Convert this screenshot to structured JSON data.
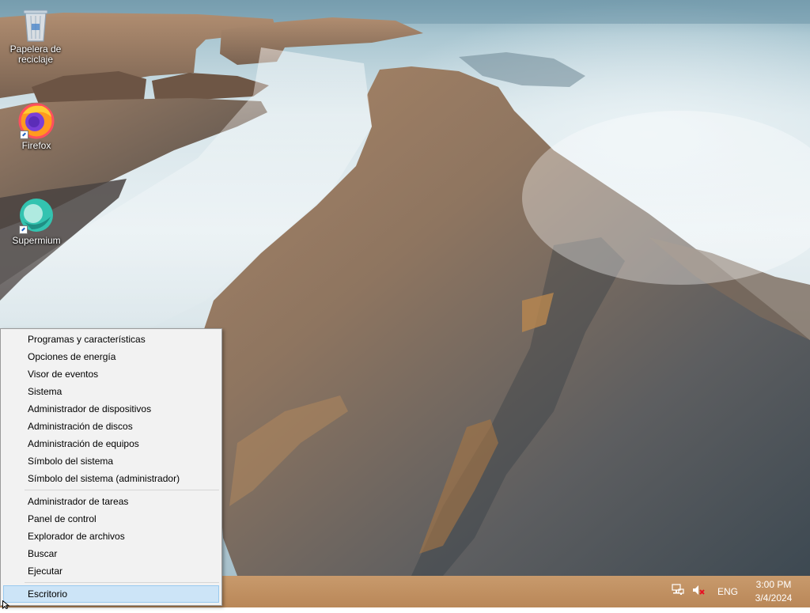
{
  "desktop": {
    "icons": [
      {
        "label": "Papelera de reciclaje",
        "icon": "recycle-bin-icon"
      },
      {
        "label": "Firefox",
        "icon": "firefox-icon"
      },
      {
        "label": "Supermium",
        "icon": "supermium-icon"
      }
    ]
  },
  "context_menu": {
    "groups": [
      [
        "Programas y características",
        "Opciones de energía",
        "Visor de eventos",
        "Sistema",
        "Administrador de dispositivos",
        "Administración de discos",
        "Administración de equipos",
        "Símbolo del sistema",
        "Símbolo del sistema (administrador)"
      ],
      [
        "Administrador de tareas",
        "Panel de control",
        "Explorador de archivos",
        "Buscar",
        "Ejecutar"
      ],
      [
        "Escritorio"
      ]
    ],
    "selected": "Escritorio"
  },
  "taskbar": {
    "tray": {
      "network_icon": "network-icon",
      "volume_icon": "volume-muted-icon",
      "language": "ENG",
      "time": "3:00 PM",
      "date": "3/4/2024"
    }
  },
  "colors": {
    "taskbar": "#b98758",
    "menu_background": "#f2f2f2",
    "menu_selected": "#cce4f7"
  }
}
